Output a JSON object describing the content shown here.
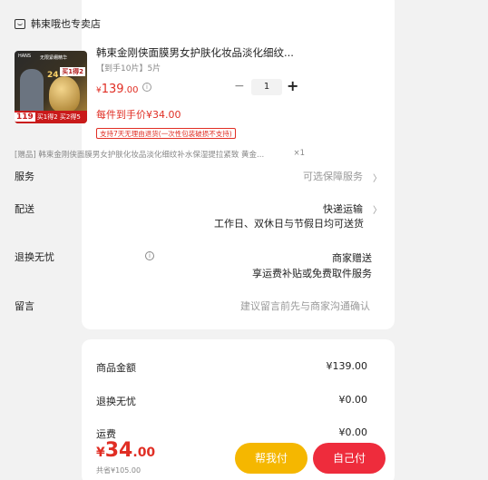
{
  "shop": {
    "name": "韩束哦也专卖店",
    "icon": "shop-icon"
  },
  "product": {
    "title": "韩束金刚侠面膜男女护肤化妆品淡化细纹...",
    "sku": "【到手10片】5片",
    "price_currency": "¥",
    "price_int": "139",
    "price_dec": ".00",
    "quantity": "1",
    "each_price": "每件到手价¥34.00",
    "refund_tag": "支持7天无理由退货(一次性包装破损不支持)",
    "thumb": {
      "brand": "HANS",
      "top_title": "无限紧绷精华",
      "tag24": "24",
      "promo_top": "买1得2",
      "price_badge": "119",
      "promo_bottom": "买1得2 买2得5"
    }
  },
  "gift": {
    "text": "[赠品] 韩束金刚侠面膜男女护肤化妆品淡化细纹补水保湿提拉紧致 黄金...",
    "qty": "×1"
  },
  "rows": {
    "service_label": "服务",
    "service_value": "可选保障服务",
    "delivery_label": "配送",
    "delivery_value": "快递运输",
    "delivery_note": "工作日、双休日与节假日均可送货",
    "return_label": "退换无忧",
    "return_value": "商家赠送",
    "return_note": "享运费补贴或免费取件服务",
    "message_label": "留言",
    "message_placeholder": "建议留言前先与商家沟通确认"
  },
  "summary": {
    "goods_label": "商品金额",
    "goods_value": "¥139.00",
    "return_label": "退换无忧",
    "return_value": "¥0.00",
    "shipping_label": "运费",
    "shipping_value": "¥0.00"
  },
  "footer": {
    "total_currency": "¥",
    "total_int": "34",
    "total_dec": ".00",
    "saved": "共省¥105.00",
    "help_pay_label": "帮我付",
    "self_pay_label": "自己付"
  },
  "colors": {
    "accent": "#e02e24",
    "help_button": "#f5b700",
    "pay_button": "#ee2c3c"
  }
}
